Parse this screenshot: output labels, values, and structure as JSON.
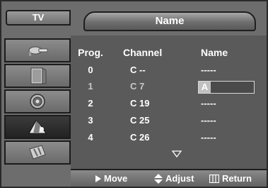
{
  "menu": {
    "tv_label": "TV",
    "title": "Name"
  },
  "sidebar": {
    "items": [
      {
        "icon": "satellite-dish-icon"
      },
      {
        "icon": "picture-frame-icon"
      },
      {
        "icon": "speaker-icon"
      },
      {
        "icon": "channel-signal-icon"
      },
      {
        "icon": "setup-tools-icon"
      }
    ],
    "active_index": 3
  },
  "table": {
    "headers": {
      "prog": "Prog.",
      "channel": "Channel",
      "name": "Name"
    },
    "rows": [
      {
        "prog": "0",
        "channel": "C --",
        "name": "-----"
      },
      {
        "prog": "1",
        "channel": "C 7",
        "name": "A"
      },
      {
        "prog": "2",
        "channel": "C 19",
        "name": "-----"
      },
      {
        "prog": "3",
        "channel": "C 25",
        "name": "-----"
      },
      {
        "prog": "4",
        "channel": "C 26",
        "name": "-----"
      }
    ]
  },
  "hints": {
    "move": "Move",
    "adjust": "Adjust",
    "return": "Return"
  },
  "colors": {
    "panel": "#5a5a5a",
    "frame": "#6d6d6d",
    "selected_row_text": "#c8c8c8"
  }
}
